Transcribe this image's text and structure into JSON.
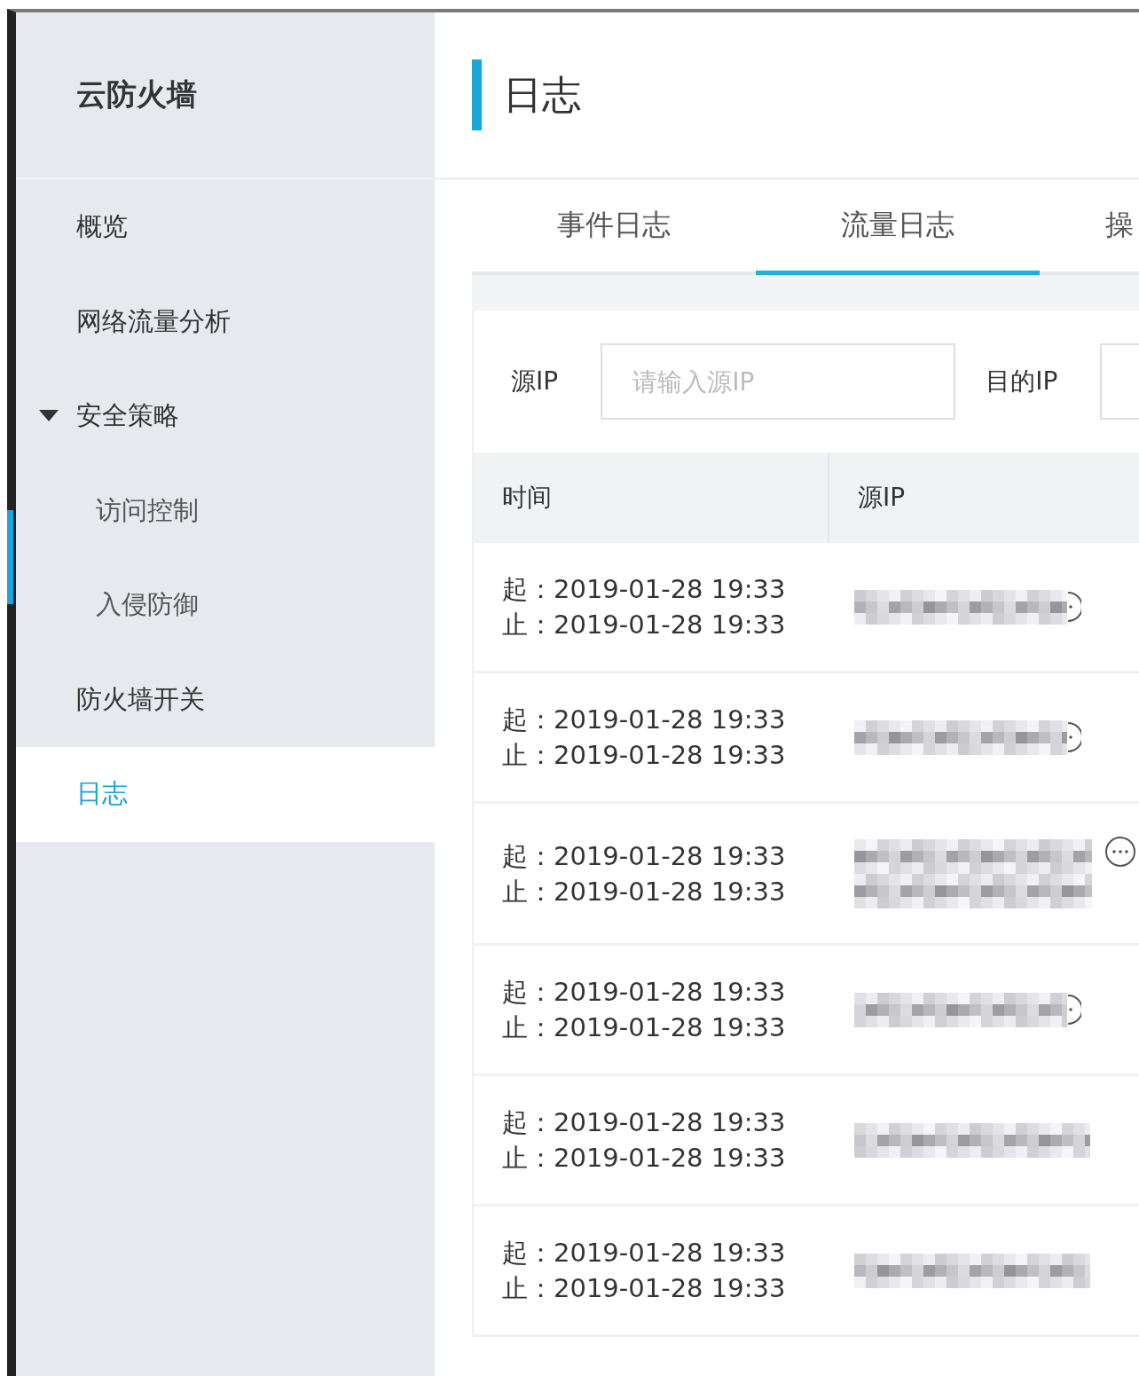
{
  "app": {
    "title": "云防火墙"
  },
  "sidebar": {
    "items": [
      {
        "label": "概览",
        "selected": false
      },
      {
        "label": "网络流量分析",
        "selected": false
      },
      {
        "label": "安全策略",
        "selected": false,
        "expanded": true,
        "children": [
          {
            "label": "访问控制",
            "selected": false
          },
          {
            "label": "入侵防御",
            "selected": false
          }
        ]
      },
      {
        "label": "防火墙开关",
        "selected": false
      },
      {
        "label": "日志",
        "selected": true
      }
    ]
  },
  "page": {
    "title": "日志"
  },
  "tabs": [
    {
      "label": "事件日志",
      "selected": false
    },
    {
      "label": "流量日志",
      "selected": true
    },
    {
      "label": "操",
      "selected": false
    }
  ],
  "filters": [
    {
      "label": "源IP",
      "placeholder": "请输入源IP"
    },
    {
      "label": "目的IP"
    }
  ],
  "table": {
    "columns": [
      "时间",
      "源IP"
    ],
    "rows": [
      {
        "start": "起：2019-01-28 19:33",
        "end": "止：2019-01-28 19:33",
        "kind": "single",
        "more_icon": true
      },
      {
        "start": "起：2019-01-28 19:33",
        "end": "止：2019-01-28 19:33",
        "kind": "single",
        "more_icon": true
      },
      {
        "start": "起：2019-01-28 19:33",
        "end": "止：2019-01-28 19:33",
        "kind": "double",
        "more_icon": true
      },
      {
        "start": "起：2019-01-28 19:33",
        "end": "止：2019-01-28 19:33",
        "kind": "single",
        "more_icon": true
      },
      {
        "start": "起：2019-01-28 19:33",
        "end": "止：2019-01-28 19:33",
        "kind": "single",
        "more_icon": false
      },
      {
        "start": "起：2019-01-28 19:33",
        "end": "止：2019-01-28 19:33",
        "kind": "single",
        "more_icon": false
      }
    ]
  }
}
